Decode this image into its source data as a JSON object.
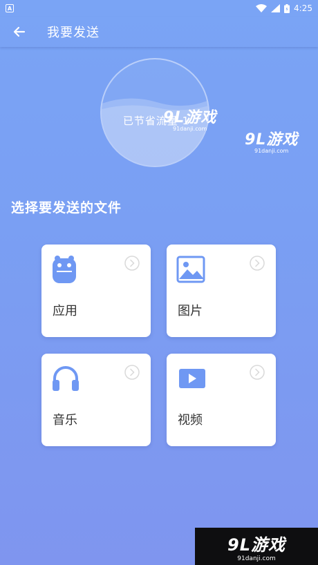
{
  "status_bar": {
    "sim_label": "A",
    "time": "4:25"
  },
  "app_bar": {
    "title": "我要发送",
    "back_icon": "arrow-left-icon"
  },
  "savings": {
    "text": "已节省流量 1"
  },
  "section": {
    "title": "选择要发送的文件"
  },
  "cards": [
    {
      "label": "应用",
      "icon": "android-app-icon"
    },
    {
      "label": "图片",
      "icon": "image-icon"
    },
    {
      "label": "音乐",
      "icon": "headphones-icon"
    },
    {
      "label": "视频",
      "icon": "video-play-icon"
    }
  ],
  "watermarks": {
    "logo_main": "9L游戏",
    "logo_sub": "91danji.com"
  },
  "colors": {
    "accent": "#6f98f3",
    "background_top": "#7aa4f5",
    "background_bottom": "#7f95ef",
    "card": "#ffffff"
  }
}
